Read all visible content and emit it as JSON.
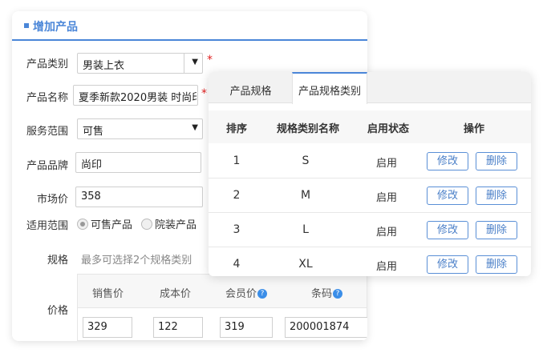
{
  "left_panel": {
    "title": "增加产品",
    "fields": {
      "category_label": "产品类别",
      "category_value": "男装上衣",
      "name_label": "产品名称",
      "name_value": "夏季新款2020男装 时尚印",
      "service_label": "服务范围",
      "service_value": "可售",
      "brand_label": "产品品牌",
      "brand_value": "尚印",
      "market_price_label": "市场价",
      "market_price_value": "358",
      "scope_label": "适用范围",
      "scope_options": [
        "可售产品",
        "院装产品"
      ],
      "spec_label": "规格",
      "spec_hint": "最多可选择2个规格类别",
      "price_label": "价格"
    },
    "required_mark": "*",
    "price_table": {
      "headers": [
        "销售价",
        "成本价",
        "会员价",
        "条码"
      ],
      "help_glyph": "?",
      "values": [
        "329",
        "122",
        "319",
        "200001874"
      ]
    }
  },
  "right_panel": {
    "tabs": [
      "产品规格",
      "产品规格类别"
    ],
    "active_tab": 1,
    "headers": [
      "排序",
      "规格类别名称",
      "启用状态",
      "操作"
    ],
    "rows": [
      {
        "order": "1",
        "name": "S",
        "status": "启用"
      },
      {
        "order": "2",
        "name": "M",
        "status": "启用"
      },
      {
        "order": "3",
        "name": "L",
        "status": "启用"
      },
      {
        "order": "4",
        "name": "XL",
        "status": "启用"
      }
    ],
    "edit_label": "修改",
    "delete_label": "删除"
  },
  "colors": {
    "accent": "#4a86d8",
    "required": "#e02020"
  },
  "icons": {
    "dropdown": "chevron-down-icon",
    "help": "question-circle-icon"
  }
}
